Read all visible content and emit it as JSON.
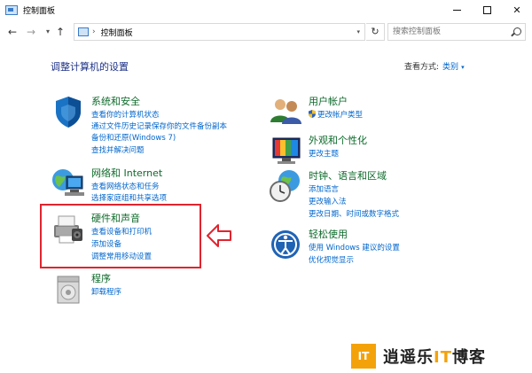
{
  "window": {
    "title": "控制面板",
    "minimize": "",
    "maximize": "",
    "close": "✕"
  },
  "address": {
    "separator": "›",
    "crumb": "控制面板",
    "refresh": "↻",
    "search_placeholder": "搜索控制面板"
  },
  "nav": {
    "back": "←",
    "forward": "→",
    "recent": "▾",
    "up": "↑"
  },
  "page": {
    "heading": "调整计算机的设置",
    "view_by_label": "查看方式:",
    "view_by_value": "类别",
    "view_by_caret": "▾"
  },
  "categories_left": [
    {
      "title": "系统和安全",
      "links": [
        "查看你的计算机状态",
        "通过文件历史记录保存你的文件备份副本",
        "备份和还原(Windows 7)",
        "查找并解决问题"
      ]
    },
    {
      "title": "网络和 Internet",
      "links": [
        "查看网络状态和任务",
        "选择家庭组和共享选项"
      ]
    },
    {
      "title": "硬件和声音",
      "links": [
        "查看设备和打印机",
        "添加设备",
        "调整常用移动设置"
      ]
    },
    {
      "title": "程序",
      "links": [
        "卸载程序"
      ]
    }
  ],
  "categories_right": [
    {
      "title": "用户帐户",
      "links": [
        "更改帐户类型"
      ]
    },
    {
      "title": "外观和个性化",
      "links": [
        "更改主题"
      ]
    },
    {
      "title": "时钟、语言和区域",
      "links": [
        "添加语言",
        "更改输入法",
        "更改日期、时间或数字格式"
      ]
    },
    {
      "title": "轻松使用",
      "links": [
        "使用 Windows 建议的设置",
        "优化视觉显示"
      ]
    }
  ],
  "watermark": {
    "logo": "IT",
    "text_a": "逍遥乐",
    "text_it": "IT",
    "text_b": "博客"
  },
  "colors": {
    "category_title": "#0d6a2a",
    "link": "#0066cc",
    "heading": "#1e3287",
    "highlight": "#e0242e",
    "watermark_accent": "#f4a20a"
  }
}
